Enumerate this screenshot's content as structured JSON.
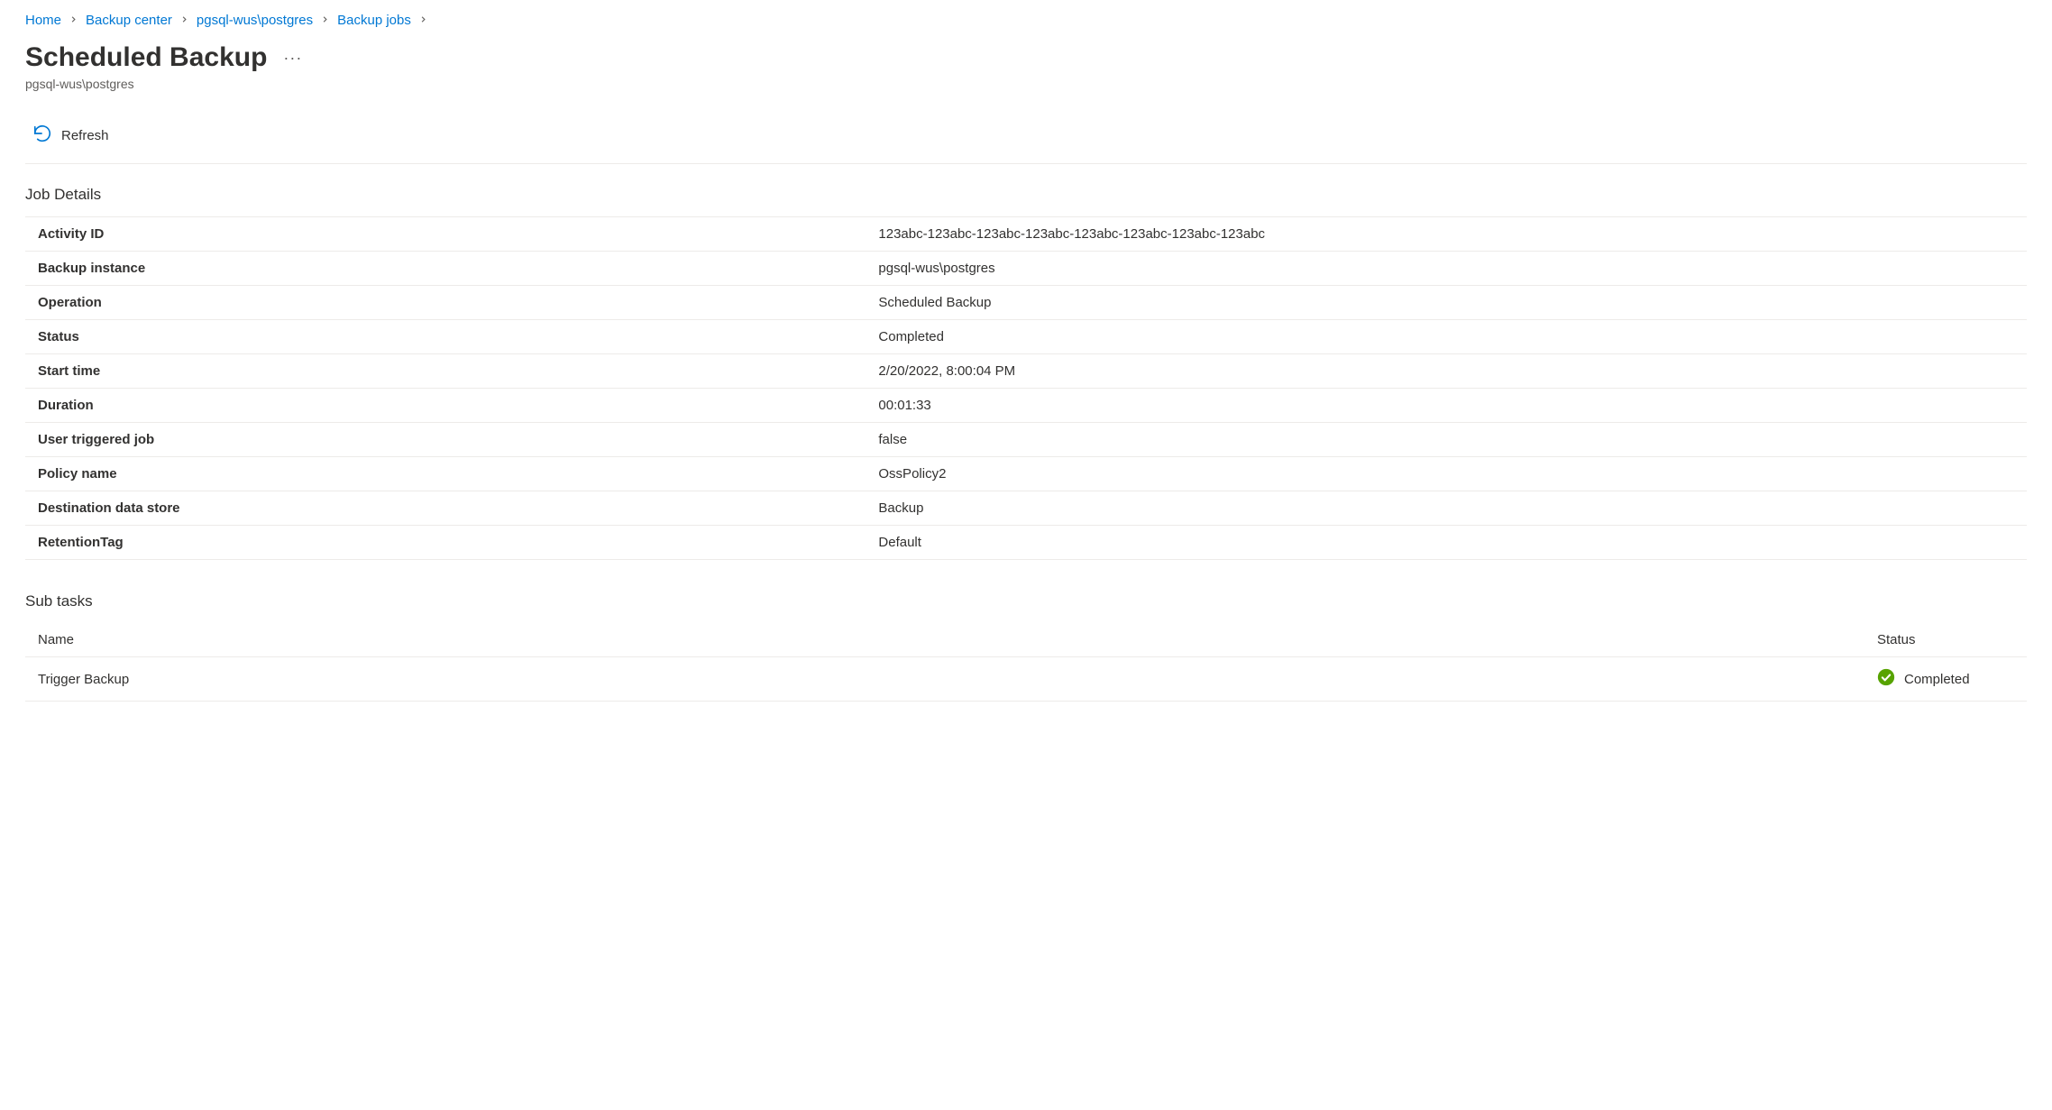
{
  "breadcrumb": {
    "items": [
      {
        "label": "Home"
      },
      {
        "label": "Backup center"
      },
      {
        "label": "pgsql-wus\\postgres"
      },
      {
        "label": "Backup jobs"
      }
    ]
  },
  "page": {
    "title": "Scheduled Backup",
    "subtitle": "pgsql-wus\\postgres"
  },
  "toolbar": {
    "refresh_label": "Refresh"
  },
  "job_details": {
    "header": "Job Details",
    "rows": [
      {
        "label": "Activity ID",
        "value": "123abc-123abc-123abc-123abc-123abc-123abc-123abc-123abc"
      },
      {
        "label": "Backup instance",
        "value": "pgsql-wus\\postgres"
      },
      {
        "label": "Operation",
        "value": "Scheduled Backup"
      },
      {
        "label": "Status",
        "value": "Completed"
      },
      {
        "label": "Start time",
        "value": "2/20/2022, 8:00:04 PM"
      },
      {
        "label": "Duration",
        "value": "00:01:33"
      },
      {
        "label": "User triggered job",
        "value": "false"
      },
      {
        "label": "Policy name",
        "value": "OssPolicy2"
      },
      {
        "label": "Destination data store",
        "value": "Backup"
      },
      {
        "label": "RetentionTag",
        "value": "Default"
      }
    ]
  },
  "subtasks": {
    "header": "Sub tasks",
    "columns": {
      "name": "Name",
      "status": "Status"
    },
    "rows": [
      {
        "name": "Trigger Backup",
        "status": "Completed"
      }
    ]
  }
}
